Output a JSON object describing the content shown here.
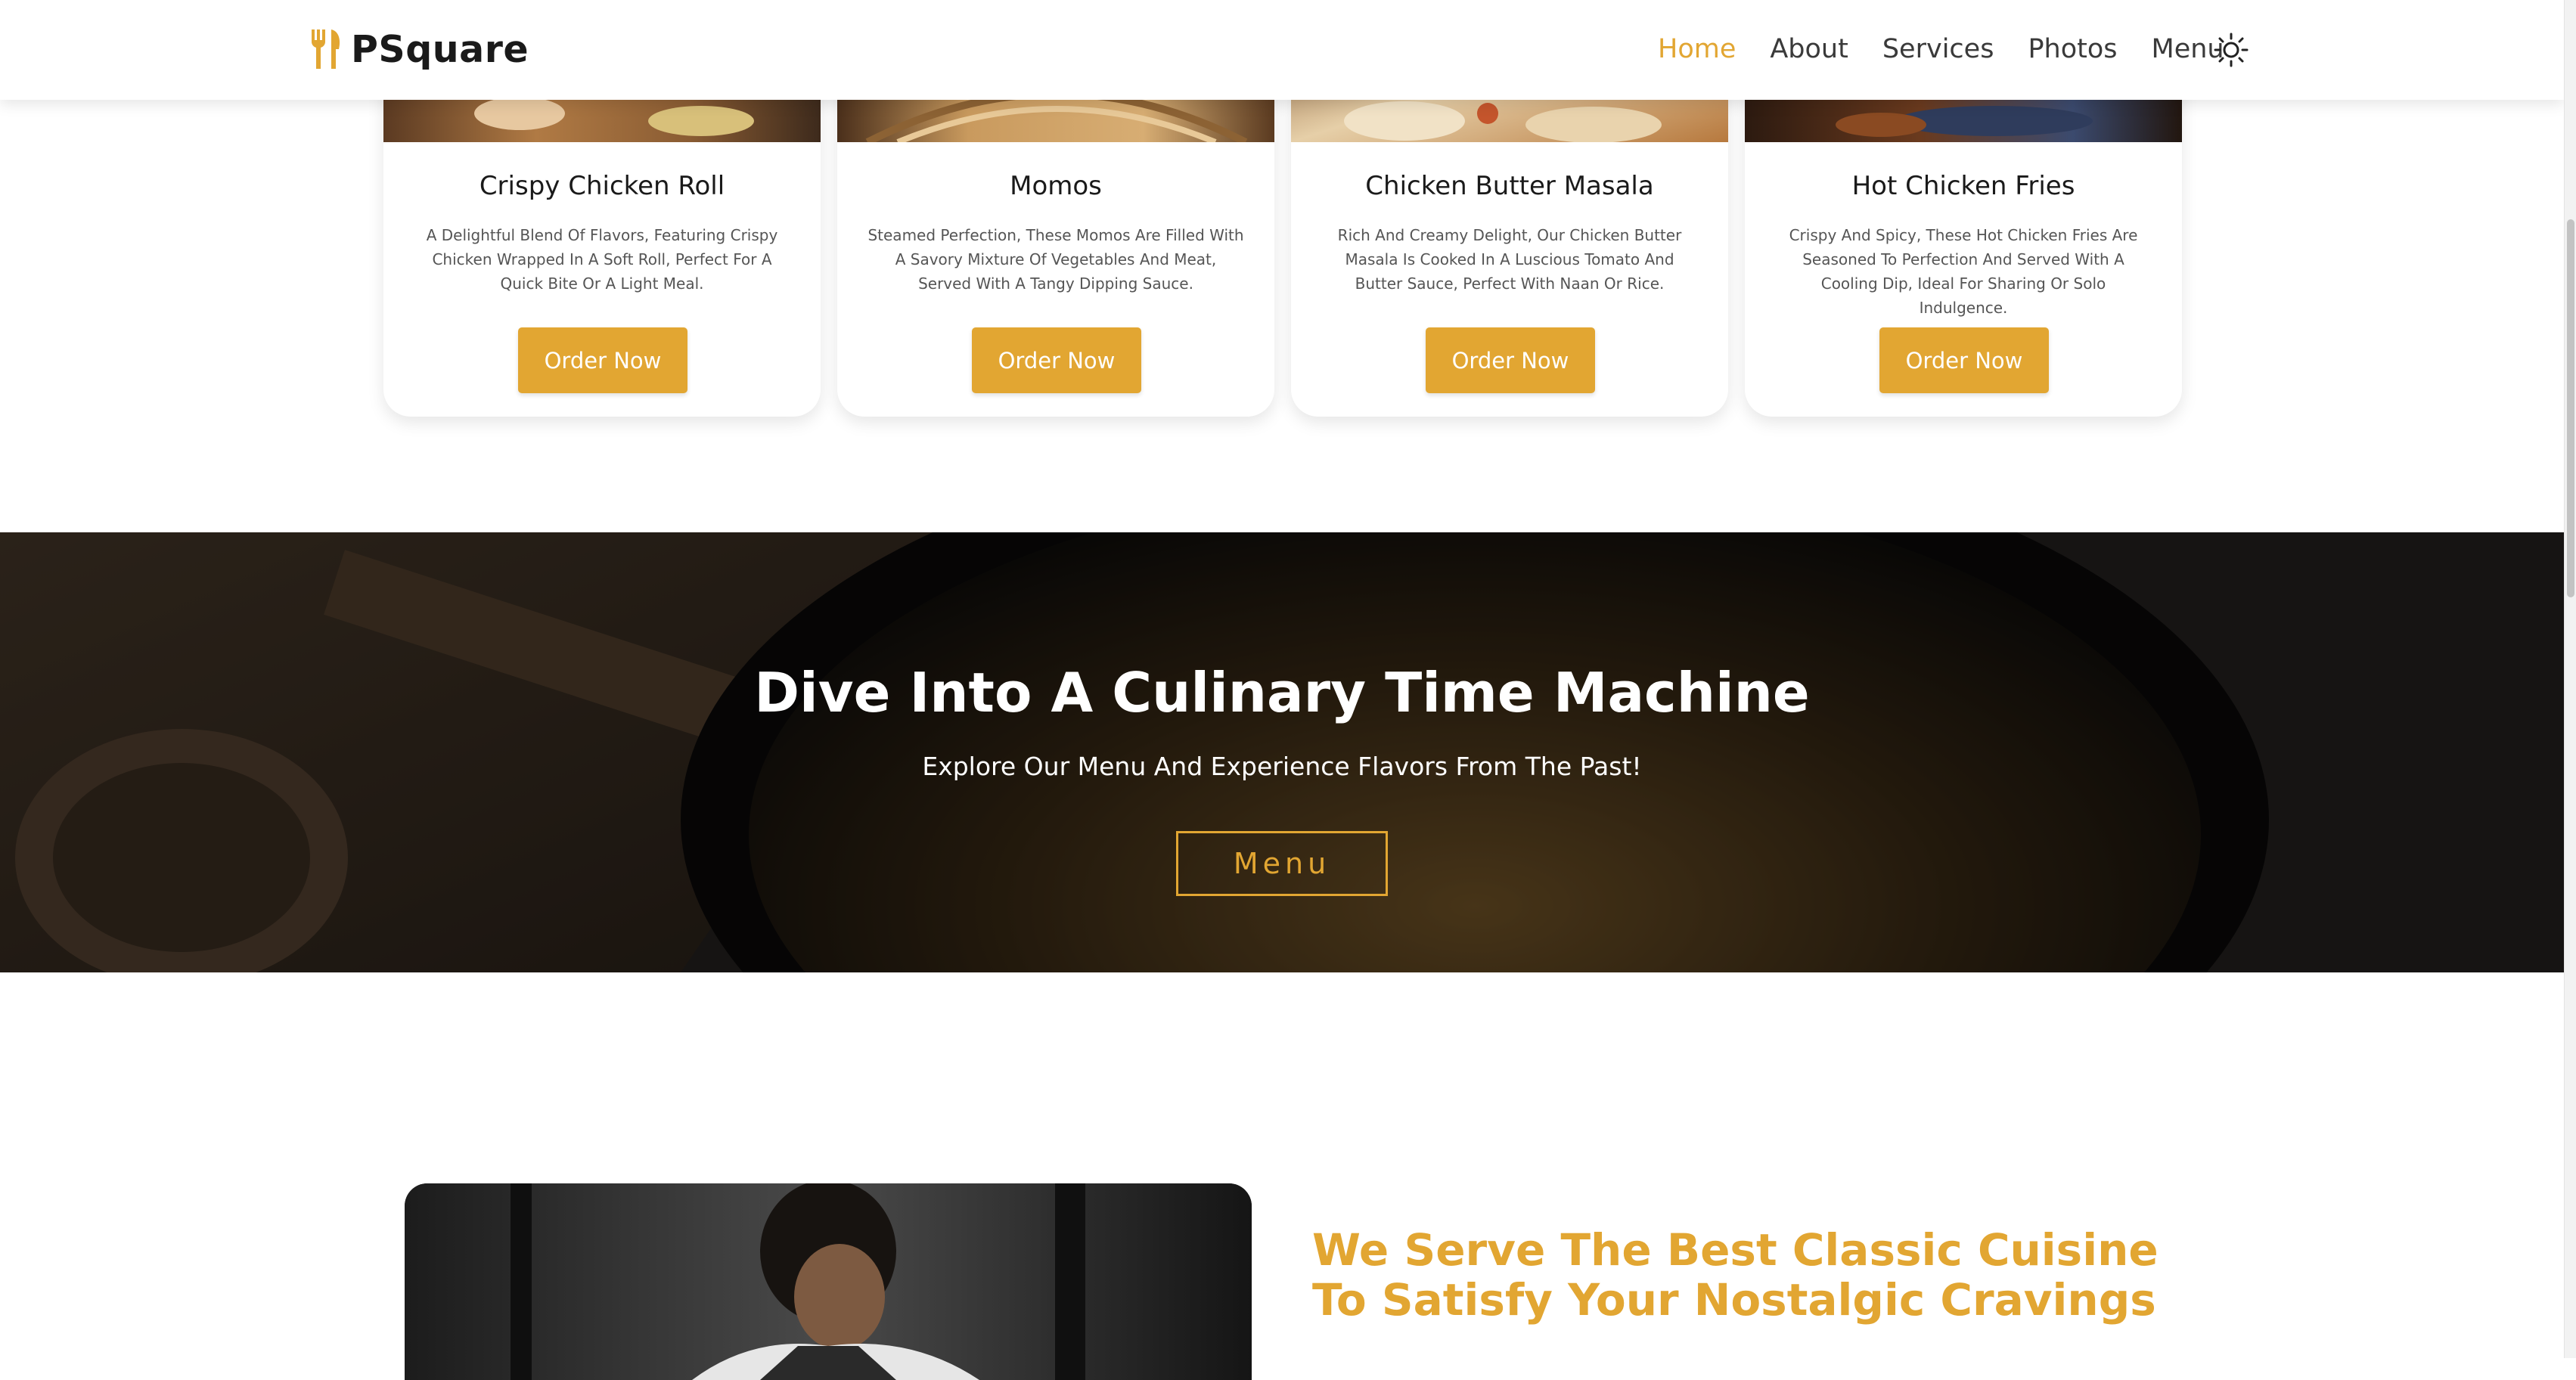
{
  "brand": {
    "name": "PSquare",
    "icon": "fork-knife-icon",
    "accent_color": "#e2a632"
  },
  "nav": {
    "items": [
      {
        "label": "Home",
        "active": true
      },
      {
        "label": "About",
        "active": false
      },
      {
        "label": "Services",
        "active": false
      },
      {
        "label": "Photos",
        "active": false
      },
      {
        "label": "Menu",
        "active": false
      }
    ],
    "theme_toggle_icon": "sun-icon"
  },
  "cards": [
    {
      "title": "Crispy Chicken Roll",
      "description": "A Delightful Blend Of Flavors, Featuring Crispy Chicken Wrapped In A Soft Roll, Perfect For A Quick Bite Or A Light Meal.",
      "button": "Order Now"
    },
    {
      "title": "Momos",
      "description": "Steamed Perfection, These Momos Are Filled With A Savory Mixture Of Vegetables And Meat, Served With A Tangy Dipping Sauce.",
      "button": "Order Now"
    },
    {
      "title": "Chicken Butter Masala",
      "description": "Rich And Creamy Delight, Our Chicken Butter Masala Is Cooked In A Luscious Tomato And Butter Sauce, Perfect With Naan Or Rice.",
      "button": "Order Now"
    },
    {
      "title": "Hot Chicken Fries",
      "description": "Crispy And Spicy, These Hot Chicken Fries Are Seasoned To Perfection And Served With A Cooling Dip, Ideal For Sharing Or Solo Indulgence.",
      "button": "Order Now"
    }
  ],
  "hero": {
    "title": "Dive Into A Culinary Time Machine",
    "subtitle": "Explore Our Menu And Experience Flavors From The Past!",
    "button": "Menu"
  },
  "about": {
    "heading": "We Serve The Best Classic Cuisine To Satisfy Your Nostalgic Cravings"
  }
}
